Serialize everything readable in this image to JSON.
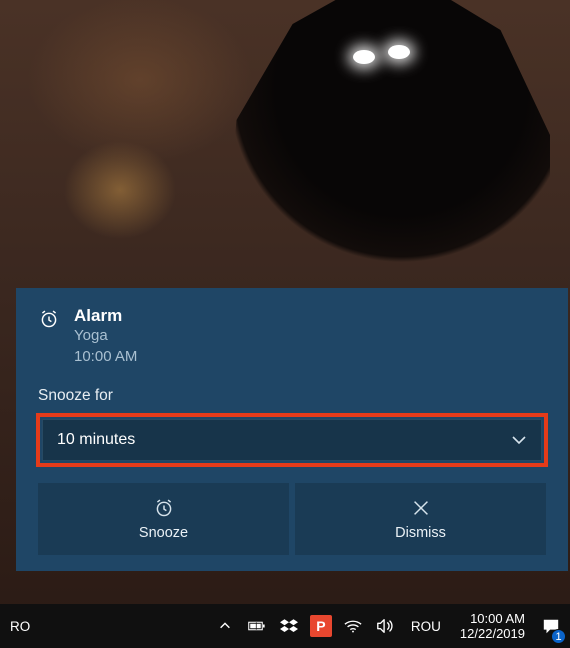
{
  "notification": {
    "title": "Alarm",
    "subtitle": "Yoga",
    "time": "10:00 AM",
    "snooze_label": "Snooze for",
    "snooze_value": "10 minutes",
    "actions": {
      "snooze": "Snooze",
      "dismiss": "Dismiss"
    }
  },
  "taskbar": {
    "input_method": "RO",
    "language": "ROU",
    "clock_time": "10:00 AM",
    "clock_date": "12/22/2019",
    "action_center_badge": "1"
  }
}
